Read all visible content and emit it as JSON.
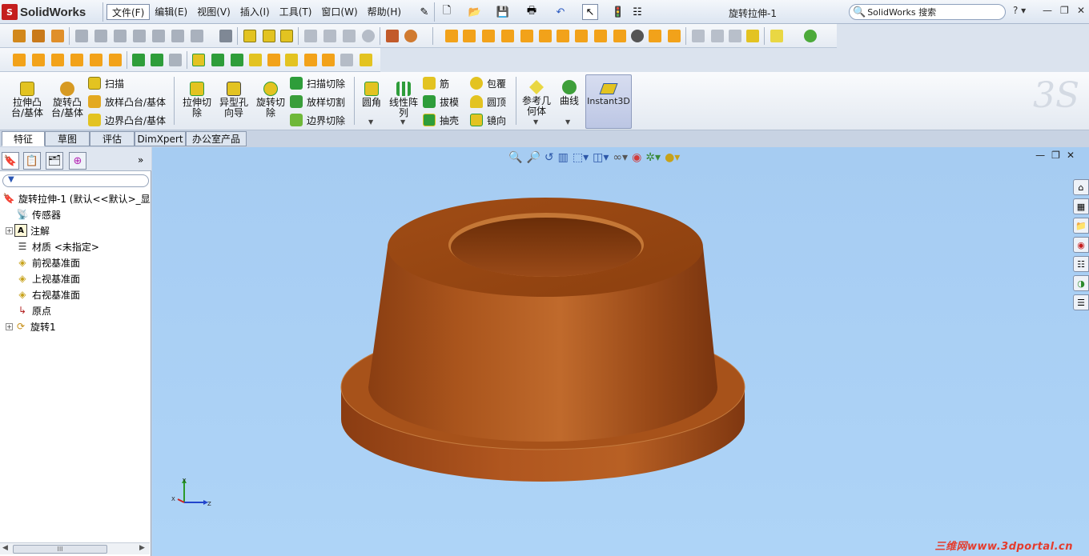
{
  "app": {
    "brand": "SolidWorks",
    "document_title": "旋转拉伸-1"
  },
  "menu": [
    {
      "label": "文件(F)",
      "active": true
    },
    {
      "label": "编辑(E)"
    },
    {
      "label": "视图(V)"
    },
    {
      "label": "插入(I)"
    },
    {
      "label": "工具(T)"
    },
    {
      "label": "窗口(W)"
    },
    {
      "label": "帮助(H)"
    }
  ],
  "search": {
    "placeholder": "SolidWorks 搜索"
  },
  "command_manager": {
    "extrude_boss": "拉伸凸\n台/基体",
    "revolve_boss": "旋转凸\n台/基体",
    "sweep": "扫描",
    "loft_boss": "放样凸台/基体",
    "boundary_boss": "边界凸台/基体",
    "extrude_cut": "拉伸切\n除",
    "hole_wizard": "异型孔\n向导",
    "revolve_cut": "旋转切\n除",
    "sweep_cut": "扫描切除",
    "loft_cut": "放样切割",
    "boundary_cut": "边界切除",
    "fillet": "圆角",
    "linear_pattern": "线性阵\n列",
    "rib": "筋",
    "draft": "拔模",
    "shell": "抽壳",
    "wrap": "包覆",
    "dome": "圆顶",
    "mirror": "镜向",
    "ref_geometry": "参考几\n何体",
    "curves": "曲线",
    "instant3d": "Instant3D"
  },
  "tabs": [
    {
      "label": "特征",
      "active": true
    },
    {
      "label": "草图"
    },
    {
      "label": "评估"
    },
    {
      "label": "DimXpert"
    },
    {
      "label": "办公室产品"
    }
  ],
  "feature_tree": {
    "root": "旋转拉伸-1 (默认<<默认>_显",
    "items": [
      {
        "label": "传感器",
        "icon": "sensor-icon",
        "expandable": false
      },
      {
        "label": "注解",
        "icon": "annotation-icon",
        "expandable": true
      },
      {
        "label": "材质 <未指定>",
        "icon": "material-icon",
        "expandable": false
      },
      {
        "label": "前视基准面",
        "icon": "plane-icon",
        "expandable": false
      },
      {
        "label": "上视基准面",
        "icon": "plane-icon",
        "expandable": false
      },
      {
        "label": "右视基准面",
        "icon": "plane-icon",
        "expandable": false
      },
      {
        "label": "原点",
        "icon": "origin-icon",
        "expandable": false
      },
      {
        "label": "旋转1",
        "icon": "revolve-icon",
        "expandable": true
      }
    ],
    "scrollbar_glyph": "III"
  },
  "triad": {
    "x": "X",
    "y": "Y",
    "z": "Z"
  },
  "watermark": "三维网www.3dportal.cn",
  "colors": {
    "viewport_bg": "#a8cef4",
    "model_copper": "#b45a1e",
    "accent_brand": "#c41e1e"
  }
}
